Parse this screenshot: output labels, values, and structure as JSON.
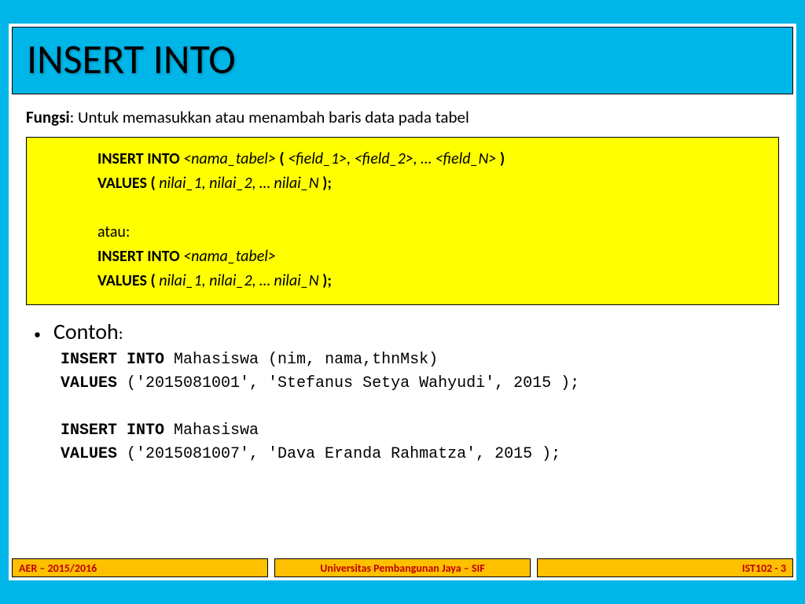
{
  "title": "INSERT INTO",
  "fungsi_label": "Fungsi",
  "fungsi_text": ": Untuk memasukkan atau menambah baris data pada tabel",
  "syntax": {
    "line1_b": "INSERT INTO ",
    "line1_i": "<nama_tabel> ",
    "line1_b2": "( ",
    "line1_i2": "<field_1>, <field_2>, … <field_N> ",
    "line1_b3": ")",
    "line2_b": "VALUES ( ",
    "line2_i": "nilai_1, nilai_2, … nilai_N ",
    "line2_b2": ");",
    "atau": "atau:",
    "line3_b": "INSERT INTO ",
    "line3_i": "<nama_tabel>",
    "line4_b": "VALUES ( ",
    "line4_i": "nilai_1, nilai_2, … nilai_N ",
    "line4_b2": ");"
  },
  "contoh_label": "Contoh",
  "contoh_colon": ":",
  "example": {
    "e1l1_b": "INSERT INTO ",
    "e1l1": "Mahasiswa (nim, nama,thnMsk)",
    "e1l2_b": "VALUES ",
    "e1l2": "('2015081001', 'Stefanus Setya Wahyudi', 2015 );",
    "e2l1_b": "INSERT INTO ",
    "e2l1": "Mahasiswa",
    "e2l2_b": "VALUES ",
    "e2l2": "('2015081007', 'Dava Eranda Rahmatza', 2015 );"
  },
  "footer": {
    "left": "AER – 2015/2016",
    "center": "Universitas Pembangunan Jaya – SIF",
    "right": "IST102 - 3"
  }
}
